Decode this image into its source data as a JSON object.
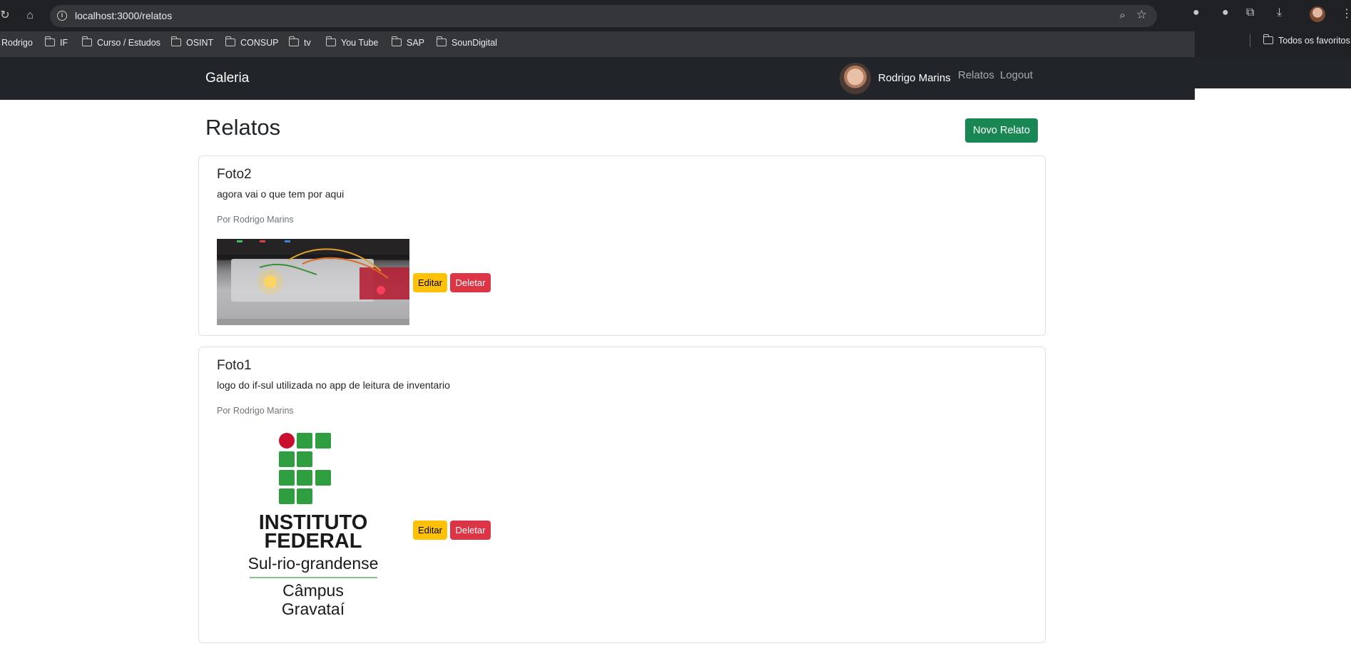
{
  "browser": {
    "url": "localhost:3000/relatos",
    "bookmarks": [
      "Rodrigo",
      "IF",
      "Curso / Estudos",
      "OSINT",
      "CONSUP",
      "tv",
      "You Tube",
      "SAP",
      "SounDigital"
    ],
    "all_bookmarks": "Todos os favoritos"
  },
  "navbar": {
    "brand": "Galeria",
    "user_name": "Rodrigo Marins",
    "links": [
      "Relatos",
      "Logout"
    ]
  },
  "page": {
    "title": "Relatos",
    "new_button": "Novo Relato"
  },
  "relatos": [
    {
      "title": "Foto2",
      "description": "agora vai o que tem por aqui",
      "author": "Por Rodrigo Marins",
      "edit_label": "Editar",
      "delete_label": "Deletar"
    },
    {
      "title": "Foto1",
      "description": "logo do if-sul utilizada no app de leitura de inventario",
      "author": "Por Rodrigo Marins",
      "edit_label": "Editar",
      "delete_label": "Deletar",
      "logo": {
        "line1": "INSTITUTO",
        "line2": "FEDERAL",
        "line3": "Sul-rio-grandense",
        "line4": "Câmpus",
        "line5": "Gravataí"
      }
    }
  ],
  "colors": {
    "navbar": "#212529",
    "success": "#198754",
    "warning": "#ffc107",
    "danger": "#dc3545",
    "if_green": "#2f9e41",
    "if_red": "#c8102e"
  }
}
